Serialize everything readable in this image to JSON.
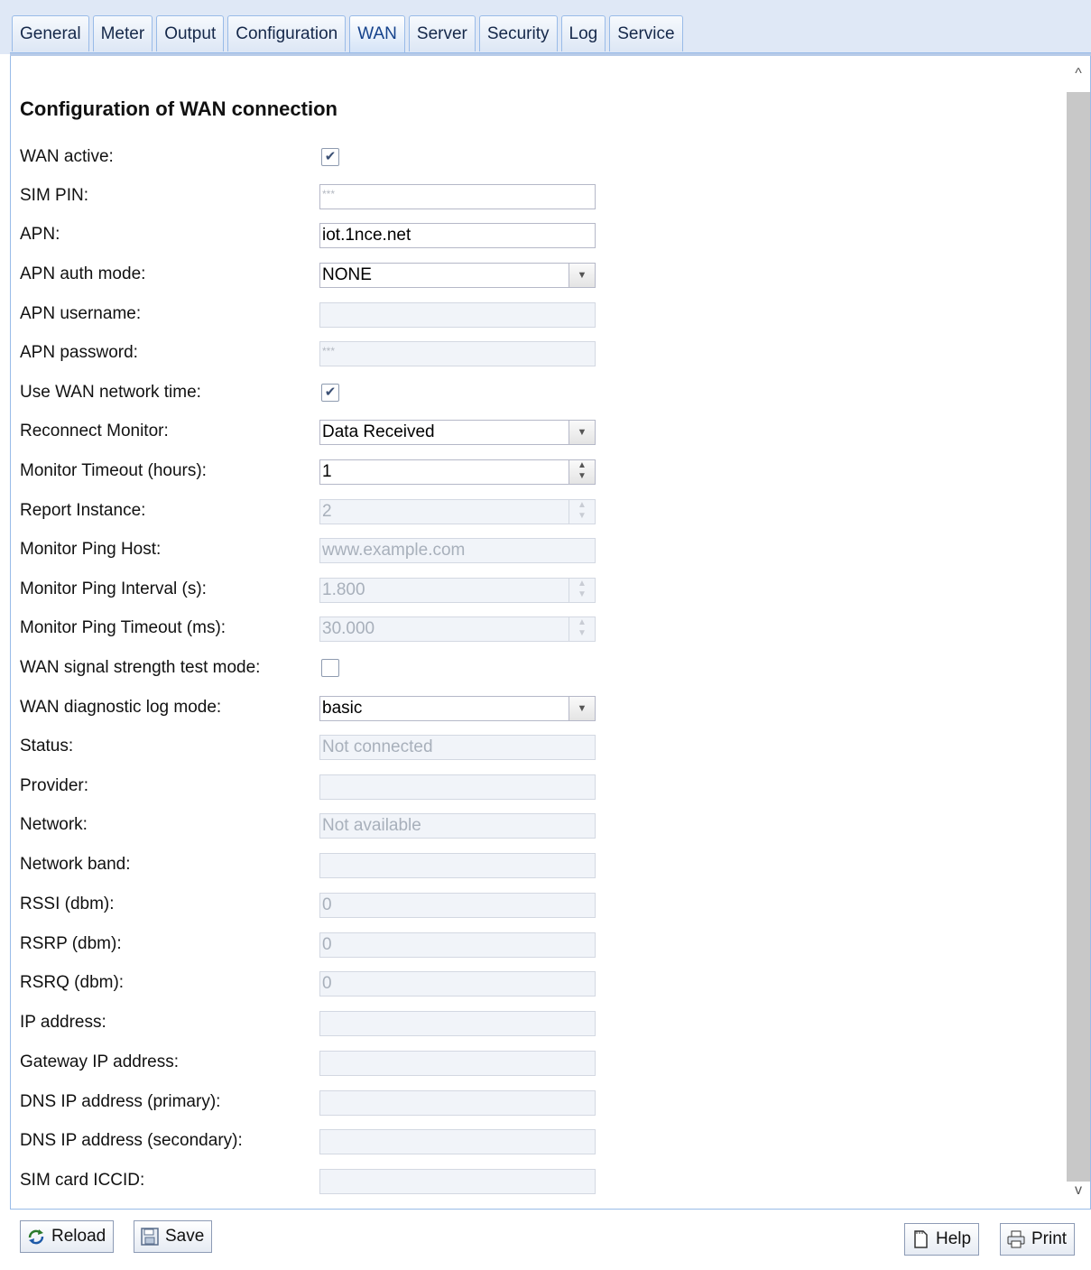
{
  "tabs": [
    {
      "label": "General"
    },
    {
      "label": "Meter"
    },
    {
      "label": "Output"
    },
    {
      "label": "Configuration"
    },
    {
      "label": "WAN",
      "active": true
    },
    {
      "label": "Server"
    },
    {
      "label": "Security"
    },
    {
      "label": "Log"
    },
    {
      "label": "Service"
    }
  ],
  "section_title": "Configuration of WAN connection",
  "form": {
    "wan_active": {
      "label": "WAN active:",
      "checked": true
    },
    "sim_pin": {
      "label": "SIM PIN:",
      "value": "***"
    },
    "apn": {
      "label": "APN:",
      "value": "iot.1nce.net"
    },
    "apn_auth_mode": {
      "label": "APN auth mode:",
      "value": "NONE"
    },
    "apn_username": {
      "label": "APN username:",
      "value": ""
    },
    "apn_password": {
      "label": "APN password:",
      "value": "***"
    },
    "use_wan_network_time": {
      "label": "Use WAN network time:",
      "checked": true
    },
    "reconnect_monitor": {
      "label": "Reconnect Monitor:",
      "value": "Data Received"
    },
    "monitor_timeout": {
      "label": "Monitor Timeout (hours):",
      "value": "1"
    },
    "report_instance": {
      "label": "Report Instance:",
      "value": "2"
    },
    "monitor_ping_host": {
      "label": "Monitor Ping Host:",
      "value": "www.example.com"
    },
    "monitor_ping_interval": {
      "label": "Monitor Ping Interval (s):",
      "value": "1.800"
    },
    "monitor_ping_timeout": {
      "label": "Monitor Ping Timeout (ms):",
      "value": "30.000"
    },
    "wan_signal_strength_test_mode": {
      "label": "WAN signal strength test mode:",
      "checked": false
    },
    "wan_diagnostic_log_mode": {
      "label": "WAN diagnostic log mode:",
      "value": "basic"
    },
    "status": {
      "label": "Status:",
      "value": "Not connected"
    },
    "provider": {
      "label": "Provider:",
      "value": ""
    },
    "network": {
      "label": "Network:",
      "value": "Not available"
    },
    "network_band": {
      "label": "Network band:",
      "value": ""
    },
    "rssi": {
      "label": "RSSI (dbm):",
      "value": "0"
    },
    "rsrp": {
      "label": "RSRP (dbm):",
      "value": "0"
    },
    "rsrq": {
      "label": "RSRQ (dbm):",
      "value": "0"
    },
    "ip_address": {
      "label": "IP address:",
      "value": ""
    },
    "gateway_ip": {
      "label": "Gateway IP address:",
      "value": ""
    },
    "dns_primary": {
      "label": "DNS IP address (primary):",
      "value": ""
    },
    "dns_secondary": {
      "label": "DNS IP address (secondary):",
      "value": ""
    },
    "sim_iccid": {
      "label": "SIM card ICCID:",
      "value": ""
    }
  },
  "toolbar": {
    "reload_label": "Reload",
    "save_label": "Save",
    "help_label": "Help",
    "print_label": "Print"
  },
  "icons": {
    "checkmark": "✔",
    "dropdown": "▼",
    "spinner_up": "▲",
    "spinner_down": "▼",
    "scroll_up": "^",
    "scroll_down": "v"
  },
  "colors": {
    "tabbar_bg": "#dfe8f6",
    "tab_border": "#99bbe8",
    "disabled_field_bg": "#f1f4f9",
    "scroll_thumb": "#c8c8c8"
  }
}
